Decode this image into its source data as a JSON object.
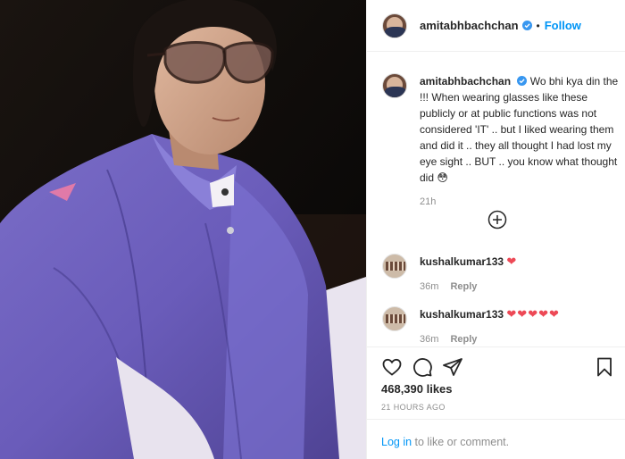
{
  "photo": {
    "description_icon": "photo"
  },
  "post": {
    "username": "amitabhbachchan",
    "dot": "•",
    "follow_label": "Follow",
    "caption_username": "amitabhbachchan",
    "caption": "Wo bhi kya din the !!! When wearing glasses like these publicly or at public functions was not considered 'IT' .. but I liked wearing them and did it .. they all thought I had lost my eye sight .. BUT .. you know what thought did 😳",
    "caption_time": "21h",
    "load_more_icon": "plus-circle-icon"
  },
  "comments": [
    {
      "username": "kushalkumar133",
      "text": "❤",
      "time": "36m",
      "reply_label": "Reply"
    },
    {
      "username": "kushalkumar133",
      "text": "❤❤❤❤❤",
      "time": "36m",
      "reply_label": "Reply"
    }
  ],
  "actions": {
    "like_icon": "heart-outline-icon",
    "comment_icon": "comment-icon",
    "share_icon": "paper-plane-icon",
    "save_icon": "bookmark-icon",
    "likes": "468,390 likes",
    "posted_ago": "21 HOURS AGO"
  },
  "login": {
    "link": "Log in",
    "rest": " to like or comment."
  },
  "colors": {
    "accent": "#0095f6",
    "heart": "#ed4956",
    "muted": "#8e8e8e",
    "text": "#262626"
  }
}
